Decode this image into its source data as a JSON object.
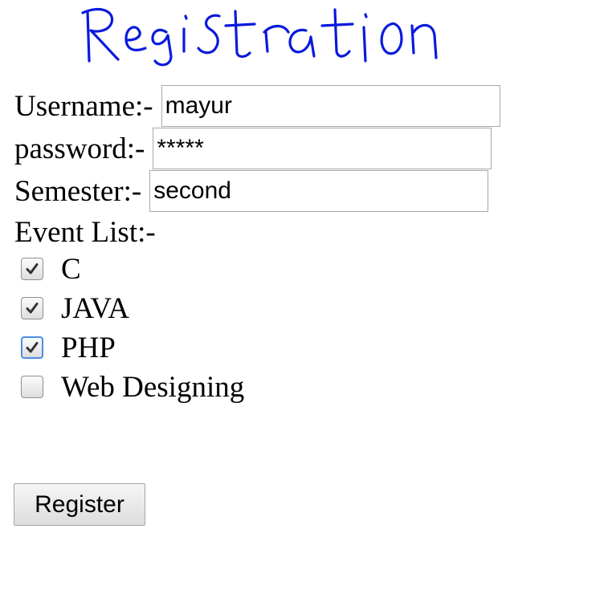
{
  "title": "Registration",
  "form": {
    "username_label": "Username:-",
    "username_value": "mayur",
    "password_label": "password:-",
    "password_value": "*****",
    "semester_label": "Semester:-",
    "semester_value": "second",
    "event_list_label": "Event List:-",
    "events": [
      {
        "label": "C",
        "checked": true,
        "focused": false
      },
      {
        "label": "JAVA",
        "checked": true,
        "focused": false
      },
      {
        "label": "PHP",
        "checked": true,
        "focused": true
      },
      {
        "label": "Web Designing",
        "checked": false,
        "focused": false
      }
    ],
    "submit_label": "Register"
  },
  "colors": {
    "title_ink": "#0a1adc",
    "focus_ring": "#4a90e2",
    "field_border": "#a9a9a9"
  }
}
